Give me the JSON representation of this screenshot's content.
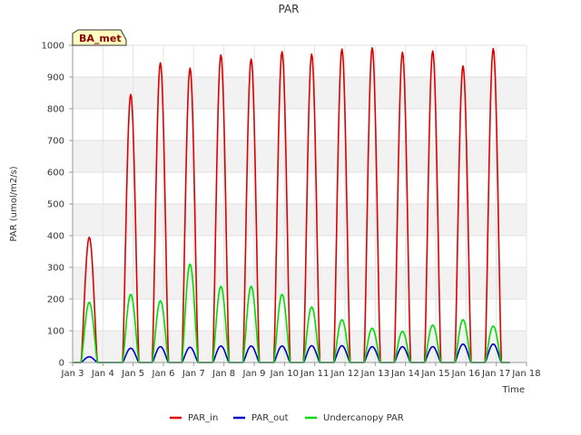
{
  "chart_data": {
    "type": "line",
    "title": "PAR",
    "xlabel": "Time",
    "ylabel": "PAR (umol/m2/s)",
    "badge": "BA_met",
    "xlim": [
      3,
      18
    ],
    "ylim": [
      0,
      1000
    ],
    "x_ticks": [
      3,
      4,
      5,
      6,
      7,
      8,
      9,
      10,
      11,
      12,
      13,
      14,
      15,
      16,
      17,
      18
    ],
    "x_tick_labels": [
      "Jan 3",
      "Jan 4",
      "Jan 5",
      "Jan 6",
      "Jan 7",
      "Jan 8",
      "Jan 9",
      "Jan 10",
      "Jan 11",
      "Jan 12",
      "Jan 13",
      "Jan 14",
      "Jan 15",
      "Jan 16",
      "Jan 17",
      "Jan 18"
    ],
    "y_ticks": [
      0,
      100,
      200,
      300,
      400,
      500,
      600,
      700,
      800,
      900,
      1000
    ],
    "y_tick_labels": [
      "0",
      "100",
      "200",
      "300",
      "400",
      "500",
      "600",
      "700",
      "800",
      "900",
      "1000"
    ],
    "grid": true,
    "legend_position": "bottom",
    "series": [
      {
        "name": "PAR_in",
        "color": "#dd0000",
        "peaks": [
          {
            "day": 3.55,
            "peak": 395
          },
          {
            "day": 4.92,
            "peak": 845
          },
          {
            "day": 5.9,
            "peak": 945
          },
          {
            "day": 6.88,
            "peak": 928
          },
          {
            "day": 7.9,
            "peak": 970
          },
          {
            "day": 8.9,
            "peak": 957
          },
          {
            "day": 9.92,
            "peak": 980
          },
          {
            "day": 10.9,
            "peak": 972
          },
          {
            "day": 11.9,
            "peak": 988
          },
          {
            "day": 12.9,
            "peak": 992
          },
          {
            "day": 13.9,
            "peak": 978
          },
          {
            "day": 14.9,
            "peak": 982
          },
          {
            "day": 15.9,
            "peak": 935
          },
          {
            "day": 16.9,
            "peak": 990
          }
        ]
      },
      {
        "name": "PAR_out",
        "color": "#0000cc",
        "peaks": [
          {
            "day": 3.55,
            "peak": 18
          },
          {
            "day": 4.92,
            "peak": 45
          },
          {
            "day": 5.9,
            "peak": 50
          },
          {
            "day": 6.88,
            "peak": 48
          },
          {
            "day": 7.9,
            "peak": 52
          },
          {
            "day": 8.9,
            "peak": 52
          },
          {
            "day": 9.92,
            "peak": 52
          },
          {
            "day": 10.9,
            "peak": 53
          },
          {
            "day": 11.9,
            "peak": 53
          },
          {
            "day": 12.9,
            "peak": 50
          },
          {
            "day": 13.9,
            "peak": 50
          },
          {
            "day": 14.9,
            "peak": 50
          },
          {
            "day": 15.9,
            "peak": 58
          },
          {
            "day": 16.9,
            "peak": 58
          }
        ]
      },
      {
        "name": "Undercanopy PAR",
        "color": "#00dd00",
        "peaks": [
          {
            "day": 3.55,
            "peak": 190
          },
          {
            "day": 4.92,
            "peak": 215
          },
          {
            "day": 5.9,
            "peak": 195
          },
          {
            "day": 6.88,
            "peak": 310
          },
          {
            "day": 7.9,
            "peak": 240
          },
          {
            "day": 8.9,
            "peak": 240
          },
          {
            "day": 9.92,
            "peak": 215
          },
          {
            "day": 10.9,
            "peak": 175
          },
          {
            "day": 11.9,
            "peak": 135
          },
          {
            "day": 12.9,
            "peak": 108
          },
          {
            "day": 13.9,
            "peak": 98
          },
          {
            "day": 14.9,
            "peak": 118
          },
          {
            "day": 15.9,
            "peak": 135
          },
          {
            "day": 16.9,
            "peak": 115
          }
        ]
      }
    ]
  }
}
